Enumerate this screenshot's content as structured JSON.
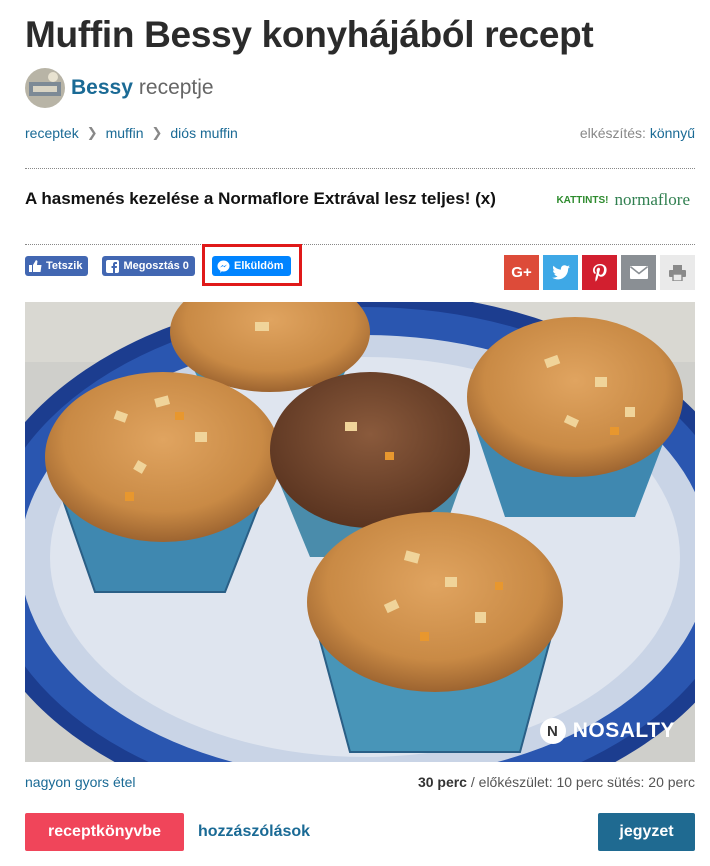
{
  "page": {
    "title": "Muffin Bessy konyhájából recept"
  },
  "author": {
    "name": "Bessy",
    "suffix": "receptje"
  },
  "breadcrumb": [
    "receptek",
    "muffin",
    "diós muffin"
  ],
  "difficulty": {
    "label": "elkészítés:",
    "value": "könnyű"
  },
  "ad": {
    "text": "A hasmenés kezelése a Normaflore Extrával lesz teljes! (x)",
    "cta": "KATTINTS!",
    "brand": "normaflore"
  },
  "social": {
    "like": "Tetszik",
    "share": "Megosztás 0",
    "send": "Elküldöm",
    "buttons": [
      {
        "name": "google-plus-icon",
        "glyph": "G+",
        "color": "#dd4b39"
      },
      {
        "name": "twitter-icon",
        "glyph": "",
        "color": "#3ea8e6"
      },
      {
        "name": "pinterest-icon",
        "glyph": "",
        "color": "#d21f2f"
      },
      {
        "name": "email-icon",
        "glyph": "",
        "color": "#8a8f94"
      },
      {
        "name": "print-icon",
        "glyph": "",
        "color": "#eaeaea"
      }
    ]
  },
  "photo": {
    "watermark": "NOSALTY",
    "watermark_letter": "N"
  },
  "meta": {
    "tag": "nagyon gyors étel",
    "total": "30 perc",
    "detail": " / előkészület: 10 perc sütés: 20 perc"
  },
  "actions": {
    "cookbook": "receptkönyvbe",
    "comments": "hozzászólások",
    "note": "jegyzet"
  }
}
